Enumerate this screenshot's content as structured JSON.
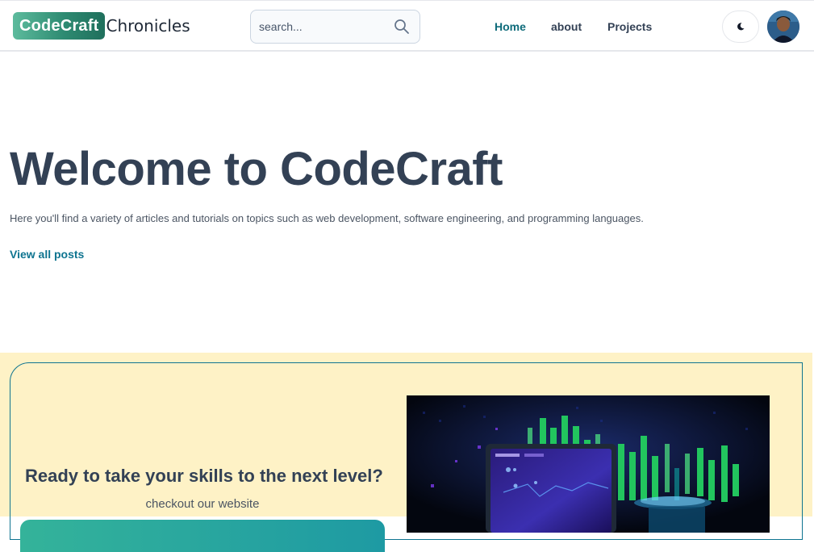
{
  "header": {
    "brand_badge": "CodeCraft",
    "brand_text": "Chronicles",
    "search_placeholder": "search...",
    "nav": [
      {
        "label": "Home",
        "active": true
      },
      {
        "label": "about",
        "active": false
      },
      {
        "label": "Projects",
        "active": false
      }
    ],
    "theme_toggle_icon": "moon-icon",
    "avatar_icon": "user-avatar"
  },
  "hero": {
    "title": "Welcome to CodeCraft",
    "subtitle": "Here you'll find a variety of articles and tutorials on topics such as web development, software engineering, and programming languages.",
    "link_label": "View all posts"
  },
  "promo": {
    "heading": "Ready to take your skills to the next level?",
    "subheading": "checkout our website",
    "image_icon": "laptop-data-visual"
  },
  "colors": {
    "accent": "#0e7490",
    "promo_background": "#fef2c6",
    "title_text": "#334155"
  }
}
